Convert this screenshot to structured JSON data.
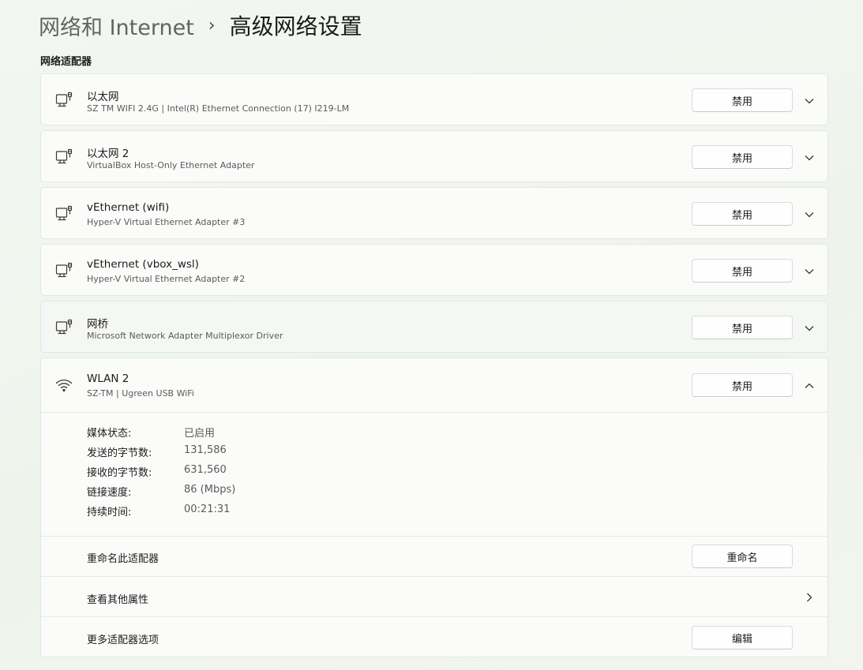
{
  "breadcrumb": {
    "parent": "网络和 Internet",
    "separator": "›",
    "current": "高级网络设置"
  },
  "section": {
    "title": "网络适配器"
  },
  "adapters": [
    {
      "name": "以太网",
      "description": "SZ TM WIFI 2.4G | Intel(R) Ethernet Connection (17) I219-LM",
      "button": "禁用",
      "icon": "ethernet-icon"
    },
    {
      "name": "以太网 2",
      "description": "VirtualBox Host-Only Ethernet Adapter",
      "button": "禁用",
      "icon": "ethernet-icon"
    },
    {
      "name": "vEthernet (wifi)",
      "description": "Hyper-V Virtual Ethernet Adapter #3",
      "button": "禁用",
      "icon": "ethernet-icon"
    },
    {
      "name": "vEthernet (vbox_wsl)",
      "description": "Hyper-V Virtual Ethernet Adapter #2",
      "button": "禁用",
      "icon": "ethernet-icon"
    },
    {
      "name": "网桥",
      "description": "Microsoft Network Adapter Multiplexor Driver",
      "button": "禁用",
      "icon": "ethernet-icon"
    }
  ],
  "expanded": {
    "name": "WLAN 2",
    "description": "SZ-TM | Ugreen USB WiFi",
    "button": "禁用",
    "icon": "wifi-icon",
    "properties": [
      {
        "label": "媒体状态:",
        "value": "已启用"
      },
      {
        "label": "发送的字节数:",
        "value": "131,586"
      },
      {
        "label": "接收的字节数:",
        "value": "631,560"
      },
      {
        "label": "链接速度:",
        "value": "86 (Mbps)"
      },
      {
        "label": "持续时间:",
        "value": "00:21:31"
      }
    ],
    "rename": {
      "label": "重命名此适配器",
      "button": "重命名"
    },
    "more_props": {
      "label": "查看其他属性"
    },
    "more_options": {
      "label": "更多适配器选项",
      "button": "编辑"
    }
  }
}
